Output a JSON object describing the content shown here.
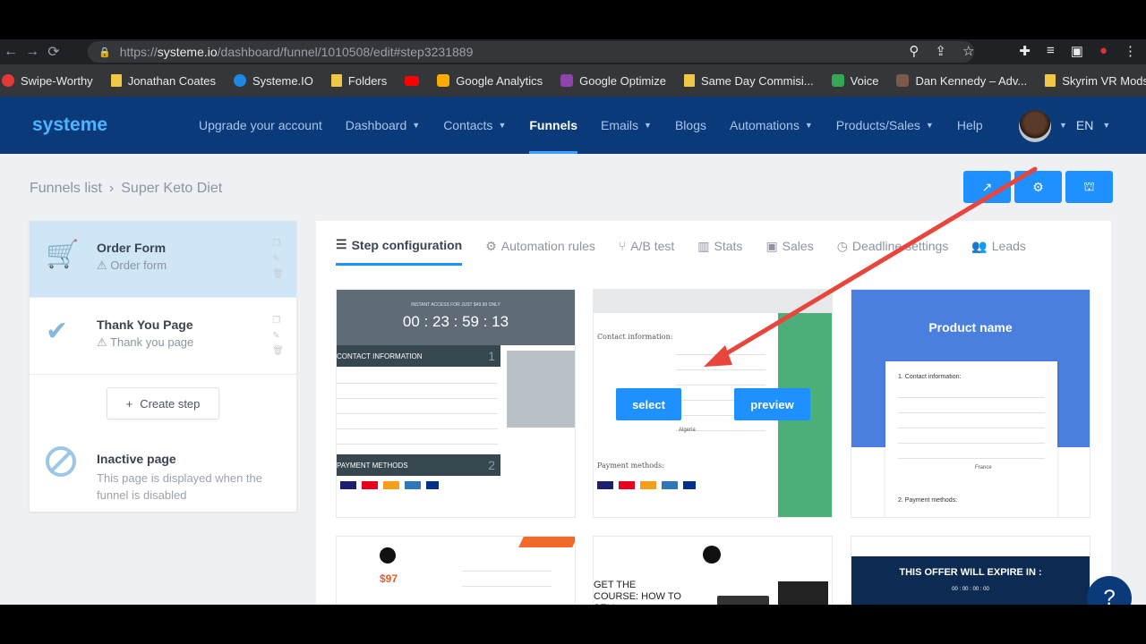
{
  "browser": {
    "url_prefix": "https://",
    "url_host": "systeme.io",
    "url_path": "/dashboard/funnel/1010508/edit#step3231889",
    "bookmarks": [
      "Swipe-Worthy",
      "Jonathan Coates",
      "Systeme.IO",
      "Folders",
      "",
      "Google Analytics",
      "Google Optimize",
      "Same Day Commisi...",
      "Voice",
      "Dan Kennedy – Adv...",
      "Skyrim VR Mods"
    ]
  },
  "app": {
    "logo": "systeme",
    "nav": [
      "Upgrade your account",
      "Dashboard",
      "Contacts",
      "Funnels",
      "Emails",
      "Blogs",
      "Automations",
      "Products/Sales",
      "Help"
    ],
    "lang": "EN"
  },
  "breadcrumb": {
    "root": "Funnels list",
    "sep": "›",
    "current": "Super Keto Diet"
  },
  "steps": [
    {
      "title": "Order Form",
      "subtitle": "Order form"
    },
    {
      "title": "Thank You Page",
      "subtitle": "Thank you page"
    }
  ],
  "create_step": "Create step",
  "inactive": {
    "title": "Inactive page",
    "text": "This page is displayed when the funnel is disabled"
  },
  "tabs": [
    "Step configuration",
    "Automation rules",
    "A/B test",
    "Stats",
    "Sales",
    "Deadline settings",
    "Leads"
  ],
  "templates": {
    "t1": {
      "banner": "INSTANT ACCESS FOR JUST $49.99 ONLY",
      "timer": "00 : 23 : 59 : 13",
      "contact": "CONTACT INFORMATION",
      "payment": "PAYMENT METHODS",
      "num1": "1",
      "num2": "2"
    },
    "t2": {
      "contact": "Contact information:",
      "payment": "Payment methods:",
      "country": "Algeria",
      "select": "select",
      "preview": "preview"
    },
    "t3": {
      "product": "Product name",
      "contact": "1. Contact information:",
      "payment": "2. Payment methods:",
      "country": "France"
    },
    "t4": {
      "price": "$97"
    },
    "t5": {
      "course": "GET THE COURSE: HOW TO SELL"
    },
    "t6": {
      "offer": "THIS OFFER WILL EXPIRE IN :",
      "timer": "00 : 00 : 00 : 00"
    }
  },
  "help": "?"
}
